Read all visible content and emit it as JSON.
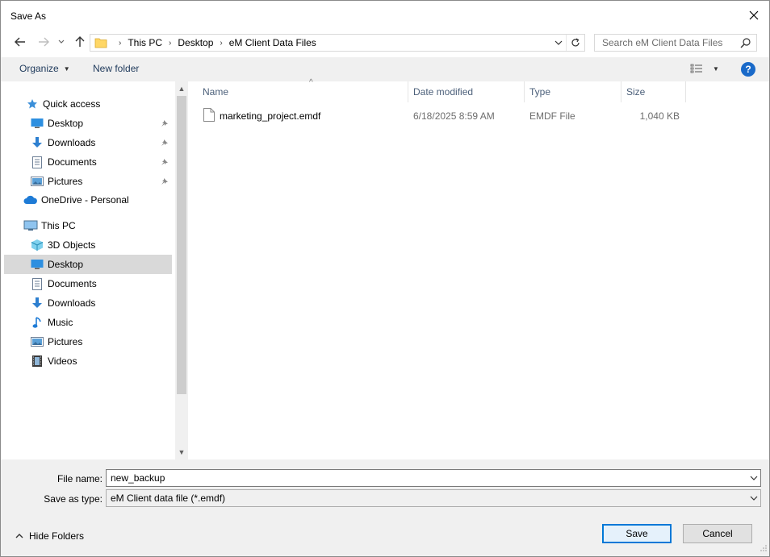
{
  "window": {
    "title": "Save As"
  },
  "address": {
    "crumbs": [
      "This PC",
      "Desktop",
      "eM Client Data Files"
    ]
  },
  "search": {
    "placeholder": "Search eM Client Data Files"
  },
  "toolbar": {
    "organize_label": "Organize",
    "new_folder_label": "New folder",
    "help_label": "?"
  },
  "nav": {
    "items": [
      {
        "label": "Quick access",
        "icon": "star-icon",
        "pinned": false
      },
      {
        "label": "Desktop",
        "icon": "desktop-icon",
        "pinned": true
      },
      {
        "label": "Downloads",
        "icon": "download-icon",
        "pinned": true
      },
      {
        "label": "Documents",
        "icon": "document-icon",
        "pinned": true
      },
      {
        "label": "Pictures",
        "icon": "pictures-icon",
        "pinned": true
      },
      {
        "label": "OneDrive - Personal",
        "icon": "cloud-icon",
        "pinned": false
      },
      {
        "label": "This PC",
        "icon": "computer-icon",
        "pinned": false
      },
      {
        "label": "3D Objects",
        "icon": "cube-icon",
        "pinned": false
      },
      {
        "label": "Desktop",
        "icon": "desktop-icon",
        "pinned": false,
        "selected": true
      },
      {
        "label": "Documents",
        "icon": "document-icon",
        "pinned": false
      },
      {
        "label": "Downloads",
        "icon": "download-icon",
        "pinned": false
      },
      {
        "label": "Music",
        "icon": "music-icon",
        "pinned": false
      },
      {
        "label": "Pictures",
        "icon": "pictures-icon",
        "pinned": false
      },
      {
        "label": "Videos",
        "icon": "video-icon",
        "pinned": false
      }
    ]
  },
  "filelist": {
    "columns": [
      "Name",
      "Date modified",
      "Type",
      "Size"
    ],
    "rows": [
      {
        "name": "marketing_project.emdf",
        "date": "6/18/2025 8:59 AM",
        "type": "EMDF File",
        "size": "1,040 KB"
      }
    ]
  },
  "form": {
    "file_name_label": "File name:",
    "file_name_value": "new_backup",
    "save_type_label": "Save as type:",
    "save_type_value": "eM Client data file (*.emdf)"
  },
  "footer": {
    "hide_folders_label": "Hide Folders",
    "save_label": "Save",
    "cancel_label": "Cancel"
  },
  "colors": {
    "accent": "#0078d7",
    "selected_nav": "#d9d9d9",
    "header_text": "#4c607a",
    "toolbar_text": "#1e395b"
  }
}
